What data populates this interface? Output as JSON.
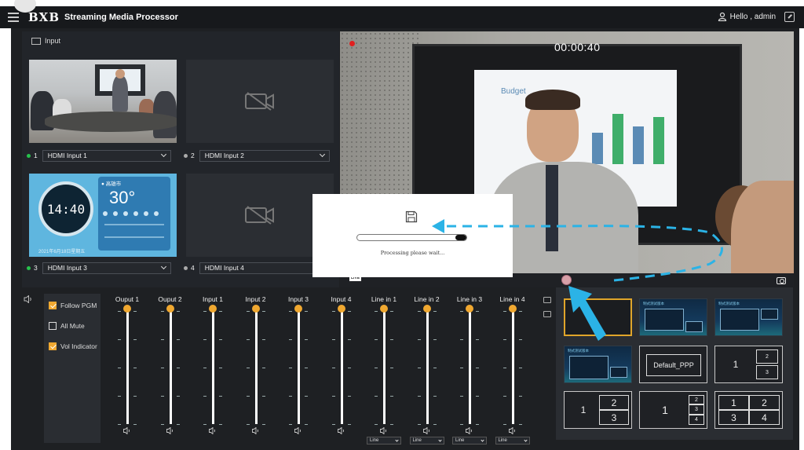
{
  "header": {
    "brand": "BXB",
    "title": "Streaming Media Processor",
    "user": "Hello , admin"
  },
  "input_panel": {
    "title": "Input",
    "sources": [
      {
        "index": "1",
        "name": "HDMI Input 1",
        "active": true
      },
      {
        "index": "2",
        "name": "HDMI Input 2",
        "active": false
      },
      {
        "index": "3",
        "name": "HDMI Input 3",
        "active": true
      },
      {
        "index": "4",
        "name": "HDMI Input 4",
        "active": false
      }
    ],
    "weather": {
      "clock": "14:40",
      "location": "高雄市",
      "temperature": "30°",
      "date": "2021年6月18日星期五"
    }
  },
  "program": {
    "timer": "00:00:40",
    "live_badge": "LIVE",
    "slide_title": "Budget"
  },
  "processing_dialog": {
    "message": "Processing please wait...",
    "progress": 0.1
  },
  "audio": {
    "options": [
      {
        "label": "Follow PGM",
        "checked": true
      },
      {
        "label": "All Mute",
        "checked": false
      },
      {
        "label": "Vol Indicator",
        "checked": true
      }
    ],
    "channels": [
      {
        "label": "Ouput 1",
        "has_select": false
      },
      {
        "label": "Ouput 2",
        "has_select": false
      },
      {
        "label": "Input 1",
        "has_select": false
      },
      {
        "label": "Input 2",
        "has_select": false
      },
      {
        "label": "Input 3",
        "has_select": false
      },
      {
        "label": "Input 4",
        "has_select": false
      },
      {
        "label": "Line in 1",
        "has_select": true,
        "select": "Line"
      },
      {
        "label": "Line in 2",
        "has_select": true,
        "select": "Line"
      },
      {
        "label": "Line in 3",
        "has_select": true,
        "select": "Line"
      },
      {
        "label": "Line in 4",
        "has_select": true,
        "select": "Line"
      }
    ]
  },
  "layouts": {
    "default_label": "Default_PPP",
    "thumb_text": "制式测试版本",
    "numbers": [
      "1",
      "2",
      "3",
      "4"
    ]
  },
  "colors": {
    "accent": "#f0a830",
    "selected_border": "#e0a52a",
    "annotation": "#2bb3e6",
    "record": "#e02020"
  }
}
